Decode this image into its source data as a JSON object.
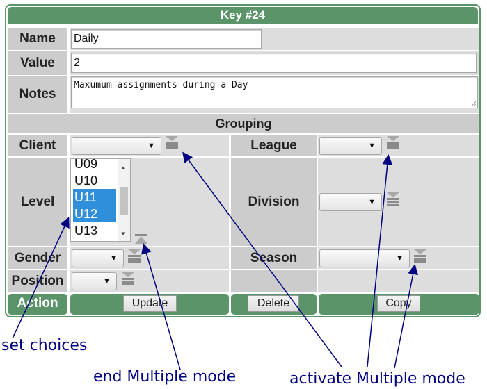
{
  "header": {
    "title": "Key #24"
  },
  "fields": {
    "name": {
      "label": "Name",
      "value": "Daily"
    },
    "value": {
      "label": "Value",
      "value": "2"
    },
    "notes": {
      "label": "Notes",
      "value": "Maxumum assignments during a Day"
    }
  },
  "grouping": {
    "title": "Grouping",
    "client": {
      "label": "Client",
      "selected": ""
    },
    "league": {
      "label": "League",
      "selected": ""
    },
    "level": {
      "label": "Level",
      "options": [
        "U09",
        "U10",
        "U11",
        "U12",
        "U13"
      ],
      "selected": [
        "U11",
        "U12"
      ]
    },
    "division": {
      "label": "Division",
      "selected": ""
    },
    "gender": {
      "label": "Gender",
      "selected": ""
    },
    "season": {
      "label": "Season",
      "selected": ""
    },
    "position": {
      "label": "Position",
      "selected": ""
    }
  },
  "action": {
    "label": "Action",
    "update": "Update",
    "delete": "Delete",
    "copy": "Copy"
  },
  "icons": {
    "activate_multiple": "activate-multiple-icon",
    "end_multiple": "end-multiple-icon",
    "dropdown": "chevron-down-icon"
  },
  "annotations": {
    "set_choices": "set choices",
    "end_multiple": "end Multiple mode",
    "activate_multiple": "activate Multiple mode"
  },
  "colors": {
    "accent": "#5b9468",
    "annotation": "#000080",
    "selection": "#2f8fdb"
  }
}
